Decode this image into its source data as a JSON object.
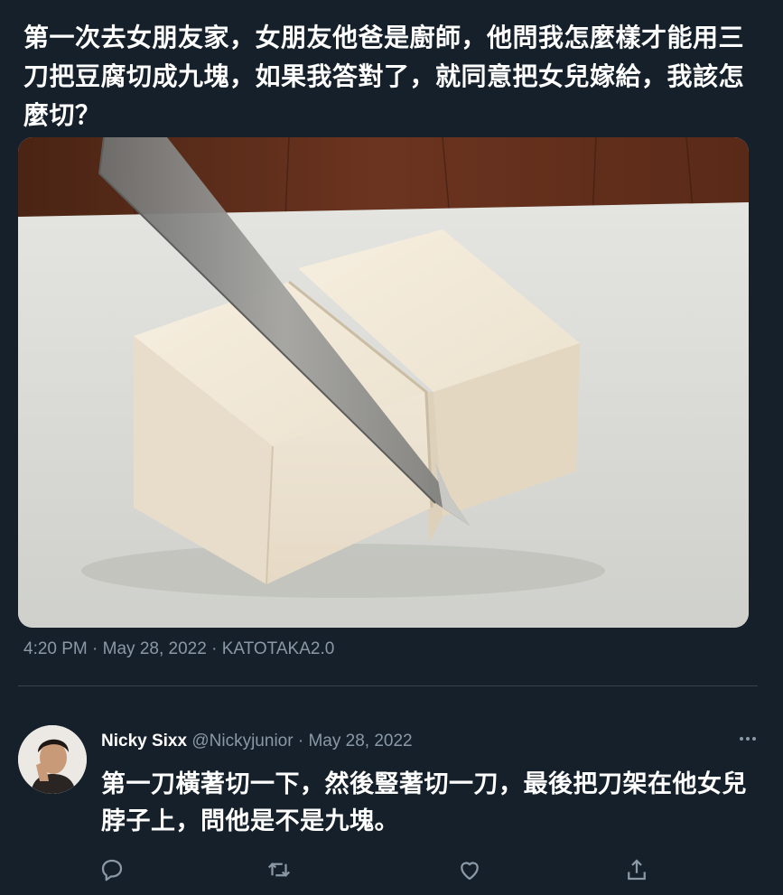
{
  "tweet": {
    "text": "第一次去女朋友家，女朋友他爸是廚師，他問我怎麼樣才能用三刀把豆腐切成九塊，如果我答對了，就同意把女兒嫁給，我該怎麼切？",
    "time": "4:20 PM",
    "separator": " · ",
    "date": "May 28, 2022",
    "source": "KATOTAKA2.0"
  },
  "reply": {
    "name": "Nicky Sixx",
    "handle": "@Nickyjunior",
    "separator": " · ",
    "date": "May 28, 2022",
    "text": "第一刀橫著切一下，然後豎著切一刀，最後把刀架在他女兒脖子上，問他是不是九塊。"
  },
  "icons": {
    "more": "more-horizontal-icon",
    "reply": "reply-icon",
    "retweet": "retweet-icon",
    "like": "like-icon",
    "share": "share-icon"
  },
  "colors": {
    "background": "#15202b",
    "text": "#ffffff",
    "muted": "#8b98a5",
    "divider": "#38444d"
  }
}
